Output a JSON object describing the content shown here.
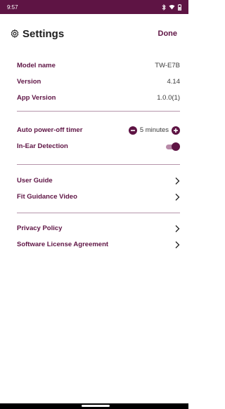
{
  "status_bar": {
    "time": "9:57"
  },
  "header": {
    "title": "Settings",
    "done_label": "Done"
  },
  "device_info": [
    {
      "label": "Model name",
      "value": "TW-E7B"
    },
    {
      "label": "Version",
      "value": "4.14"
    },
    {
      "label": "App Version",
      "value": "1.0.0(1)"
    }
  ],
  "controls": {
    "auto_power_off": {
      "label": "Auto power-off timer",
      "value": "5 minutes"
    },
    "in_ear_detection": {
      "label": "In-Ear Detection",
      "enabled": true
    }
  },
  "guides": [
    {
      "label": "User Guide"
    },
    {
      "label": "Fit Guidance Video"
    }
  ],
  "legal": [
    {
      "label": "Privacy Policy"
    },
    {
      "label": "Software License Agreement"
    }
  ],
  "colors": {
    "accent": "#5e1444",
    "status_bar": "#5e1444",
    "divider": "#5e1444"
  },
  "icons": [
    "gear-icon",
    "bluetooth-icon",
    "wifi-icon",
    "battery-icon",
    "minus-icon",
    "plus-icon",
    "chevron-right-icon"
  ]
}
